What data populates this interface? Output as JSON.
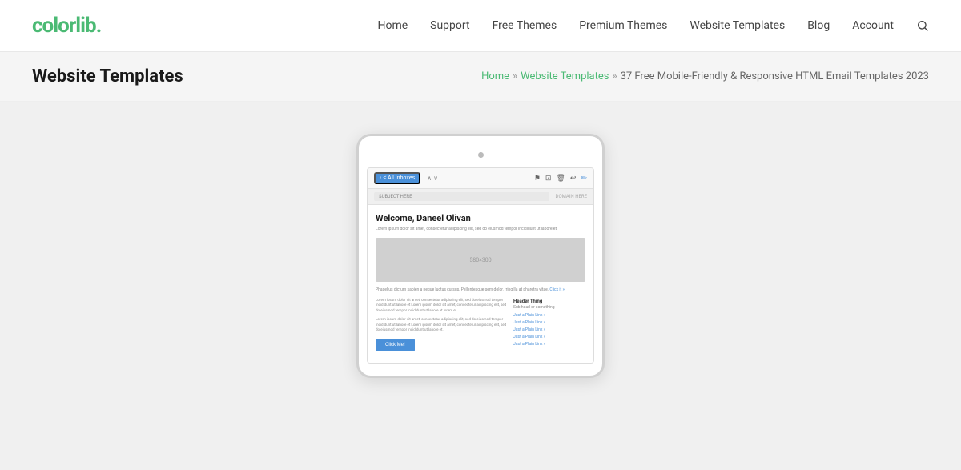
{
  "brand": {
    "name": "colorlib",
    "dot_color": "#4bba74"
  },
  "nav": {
    "items": [
      {
        "id": "home",
        "label": "Home"
      },
      {
        "id": "support",
        "label": "Support"
      },
      {
        "id": "free-themes",
        "label": "Free Themes"
      },
      {
        "id": "premium-themes",
        "label": "Premium Themes"
      },
      {
        "id": "website-templates",
        "label": "Website Templates"
      },
      {
        "id": "blog",
        "label": "Blog"
      },
      {
        "id": "account",
        "label": "Account"
      }
    ]
  },
  "breadcrumb_bar": {
    "page_title": "Website Templates",
    "home_label": "Home",
    "sep1": "»",
    "website_templates_label": "Website Templates",
    "sep2": "»",
    "current": "37 Free Mobile-Friendly & Responsive HTML Email Templates 2023"
  },
  "email_mockup": {
    "back_label": "< All Inboxes",
    "subject_placeholder": "SUBJECT HERE",
    "sender_name": "DOMAIN HERE",
    "greeting": "Welcome, Daneel Olivan",
    "intro_text": "Lorem ipsum dolor sit amet, consectetur adipiscing elit, sed do eiusmod tempor incididunt ut labore et.",
    "image_dimensions": "580×300",
    "paragraph1": "Phasellus dictum sapien a neque luctus cursus. Pellentesque sem dolor, fringilla at pharetra vitae.",
    "click_link": "Click it »",
    "col_left_para1": "Lorem ipsum dolor sit amet, consectetur adipiscing elit, sed do eiusmod tempor incididunt ut labore et Lorem ipsum dolor sit amet, consectetur adipiscing elit, sed do eiusmod tempor incididunt ut labore at lorem et.",
    "col_left_para2": "Lorem ipsum dolor sit amet, consectetur adipiscing elit, sed do eiusmod tempor incididunt ut labore et Lorem ipsum dolor sit amet, consectetur adipiscing elit, sed do eiusmod tempor incididunt ut labore et.",
    "cta_button_label": "Click Me!",
    "col_right_header": "Header Thing",
    "col_right_sub": "Sub-head or something",
    "right_links": [
      "Just a Plain Link »",
      "Just a Plain Link »",
      "Just a Plain Link »",
      "Just a Plain Link »",
      "Just a Plain Link »"
    ]
  }
}
